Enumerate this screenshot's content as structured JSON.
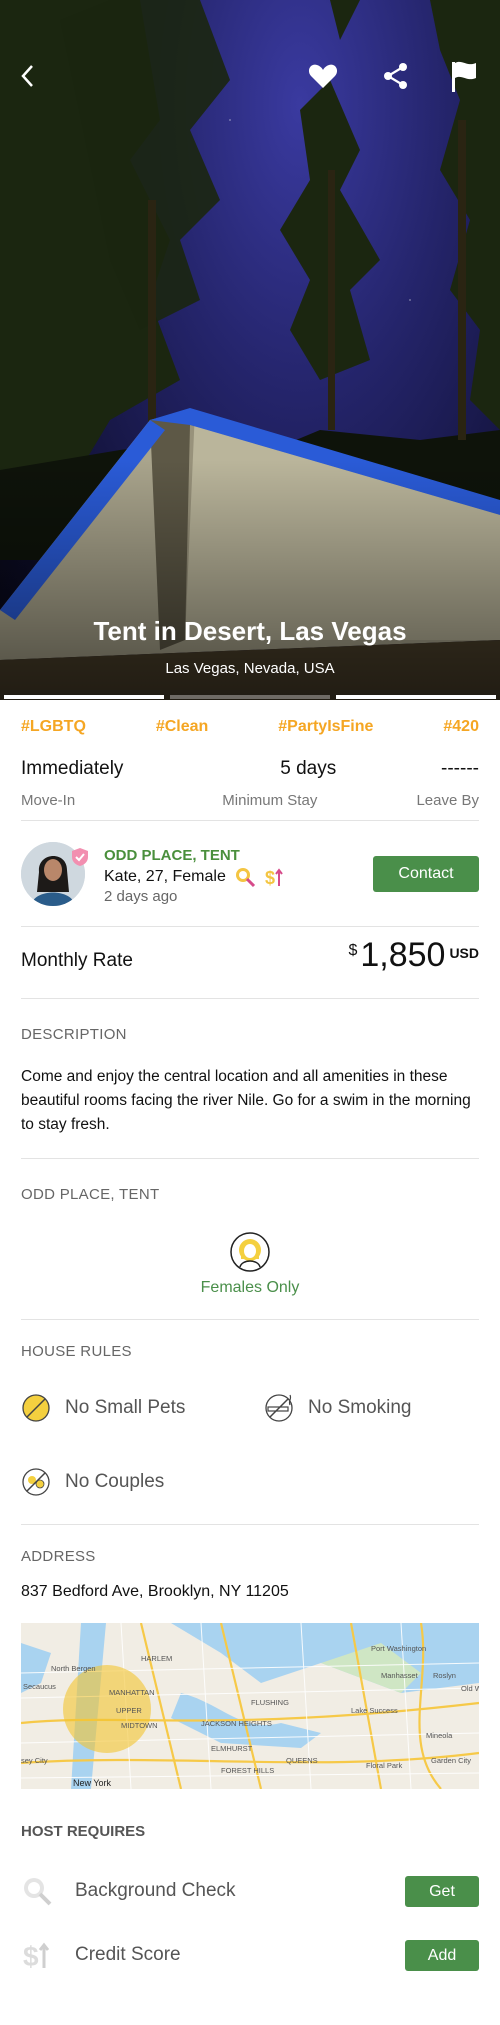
{
  "listing": {
    "title": "Tent in Desert, Las Vegas",
    "location": "Las Vegas, Nevada,  USA"
  },
  "tags": [
    "#LGBTQ",
    "#Clean",
    "#PartyIsFine",
    "#420"
  ],
  "stay": {
    "move_in_value": "Immediately",
    "move_in_label": "Move-In",
    "min_stay_value": "5 days",
    "min_stay_label": "Minimum Stay",
    "leave_by_value": "------",
    "leave_by_label": "Leave By"
  },
  "host": {
    "place": "ODD PLACE, TENT",
    "info": "Kate, 27, Female",
    "posted": "2 days ago",
    "contact_label": "Contact"
  },
  "rate": {
    "label": "Monthly Rate",
    "currency_symbol": "$",
    "amount": "1,850",
    "currency": "USD"
  },
  "description": {
    "heading": "DESCRIPTION",
    "text": "Come and enjoy the central location and all amenities in these beautiful rooms facing the river Nile. Go for a swim in the morning to stay fresh."
  },
  "place": {
    "heading": "ODD PLACE, TENT",
    "gender_rule": "Females Only"
  },
  "house_rules": {
    "heading": "HOUSE RULES",
    "items": [
      "No Small Pets",
      "No Smoking",
      "No Couples"
    ]
  },
  "address": {
    "heading": "ADDRESS",
    "text": "837 Bedford Ave, Brooklyn, NY 11205"
  },
  "map_labels": [
    "North Bergen",
    "Secaucus",
    "HARLEM",
    "MANHATTAN",
    "UPPER",
    "MIDTOWN",
    "QUEENS",
    "JACKSON HEIGHTS",
    "FLUSHING",
    "ELMHURST",
    "FOREST HILLS",
    "Port Washington",
    "Manhasset",
    "Roslyn",
    "Lake Success",
    "Mineola",
    "Floral Park",
    "Garden City",
    "New York",
    "sey City",
    "Old W"
  ],
  "host_requires": {
    "heading": "HOST REQUIRES",
    "items": [
      {
        "label": "Background Check",
        "button": "Get"
      },
      {
        "label": "Credit Score",
        "button": "Add"
      }
    ]
  },
  "colors": {
    "accent_green": "#4a8f4a",
    "tag_orange": "#f5a623",
    "host_green": "#4a8f3c"
  },
  "icons": [
    "back-icon",
    "heart-icon",
    "share-icon",
    "flag-icon"
  ]
}
